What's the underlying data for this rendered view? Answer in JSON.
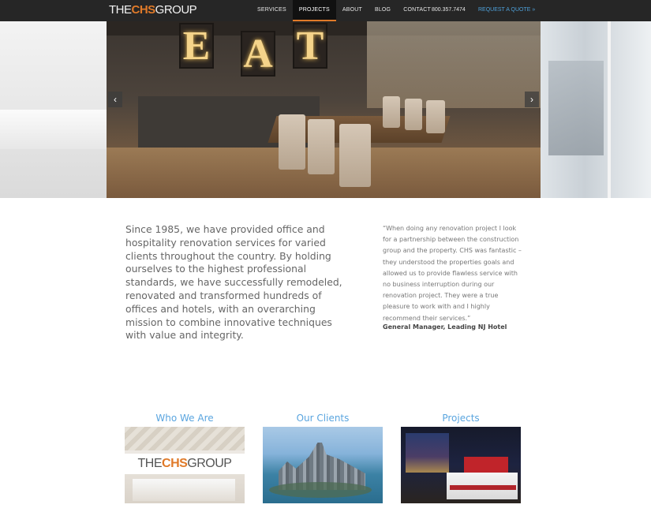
{
  "header": {
    "logo": {
      "prefix": "THE",
      "middle": "CHS",
      "suffix": "GROUP"
    },
    "nav": [
      "SERVICES",
      "PROJECTS",
      "ABOUT",
      "BLOG",
      "CONTACT"
    ],
    "active_nav": "PROJECTS",
    "phone": "800.357.7474",
    "quote_link": "REQUEST A QUOTE »"
  },
  "slider": {
    "sign_letters": [
      "E",
      "A",
      "T"
    ],
    "prev_icon": "‹",
    "next_icon": "›"
  },
  "intro": {
    "text": "Since 1985, we have provided office and hospitality renovation services for varied clients throughout the country. By holding ourselves to the highest professional standards, we have successfully remodeled, renovated and transformed hundreds of offices and hotels, with an overarching mission to combine innovative techniques with value and integrity."
  },
  "testimonial": {
    "quote": "“When doing any renovation project I look for a partnership between the construction group and the property. CHS was fantastic – they understood the properties goals and allowed us to provide flawless service with no business interruption during our renovation project. They were a true pleasure to work with and I highly recommend their services.”",
    "author": "General Manager, Leading NJ Hotel"
  },
  "cards": [
    {
      "title": "Who We Are",
      "logo": {
        "prefix": "THE",
        "middle": "CHS",
        "suffix": "GROUP"
      }
    },
    {
      "title": "Our Clients"
    },
    {
      "title": "Projects"
    }
  ],
  "colors": {
    "accent": "#e07a29",
    "link": "#4ea0d9",
    "card_title": "#5aa5df",
    "topbar": "#262626"
  }
}
